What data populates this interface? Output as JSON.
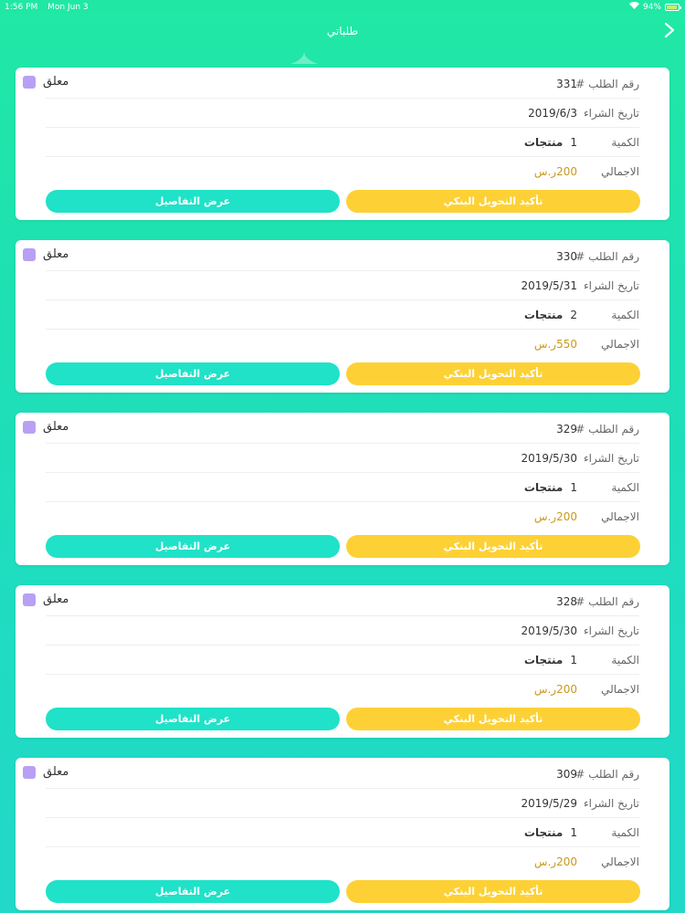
{
  "status_bar": {
    "time": "1:56 PM",
    "date": "Mon Jun 3",
    "battery": "94%",
    "battery_level": 0.94
  },
  "nav": {
    "title": "طلباتي"
  },
  "labels": {
    "order_number": "رقم الطلب #",
    "purchase_date": "تاريخ الشراء",
    "quantity": "الكمية",
    "total": "الاجمالي",
    "products": "منتجات",
    "confirm_button": "تأكيد التحويل البنكي",
    "details_button": "عرض التفاصيل"
  },
  "colors": {
    "status_pending": "#b8a0f5",
    "confirm_button": "#fdd135",
    "details_button": "#1fe2c8",
    "total_text": "#c89a1a"
  },
  "orders": [
    {
      "status": "معلق",
      "number": "331",
      "date": "2019/6/3",
      "quantity": "1",
      "total": "200ر.س"
    },
    {
      "status": "معلق",
      "number": "330",
      "date": "2019/5/31",
      "quantity": "2",
      "total": "550ر.س"
    },
    {
      "status": "معلق",
      "number": "329",
      "date": "2019/5/30",
      "quantity": "1",
      "total": "200ر.س"
    },
    {
      "status": "معلق",
      "number": "328",
      "date": "2019/5/30",
      "quantity": "1",
      "total": "200ر.س"
    },
    {
      "status": "معلق",
      "number": "309",
      "date": "2019/5/29",
      "quantity": "1",
      "total": "200ر.س"
    }
  ]
}
